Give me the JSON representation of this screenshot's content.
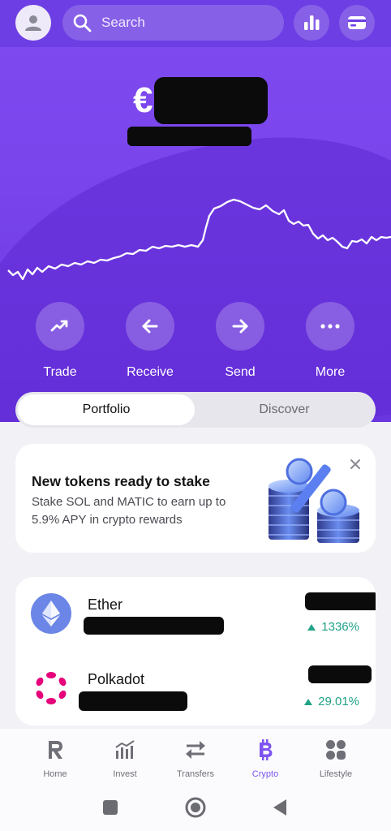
{
  "search": {
    "placeholder": "Search"
  },
  "balance": {
    "currency_symbol": "€"
  },
  "actions": [
    {
      "label": "Trade",
      "icon": "trend-up-icon"
    },
    {
      "label": "Receive",
      "icon": "arrow-left-icon"
    },
    {
      "label": "Send",
      "icon": "arrow-right-icon"
    },
    {
      "label": "More",
      "icon": "more-dots-icon"
    }
  ],
  "segments": {
    "portfolio": "Portfolio",
    "discover": "Discover",
    "selected": "Portfolio"
  },
  "promo": {
    "title": "New tokens ready to stake",
    "text": "Stake SOL and MATIC to earn up to 5.9% APY in crypto rewards"
  },
  "assets": [
    {
      "name": "Ether",
      "change": "1336%",
      "icon": "ether-icon"
    },
    {
      "name": "Polkadot",
      "change": "29.01%",
      "icon": "polkadot-icon"
    }
  ],
  "nav": {
    "items": [
      {
        "label": "Home",
        "icon": "revolut-r-icon"
      },
      {
        "label": "Invest",
        "icon": "bar-chart-icon"
      },
      {
        "label": "Transfers",
        "icon": "transfer-arrows-icon"
      },
      {
        "label": "Crypto",
        "icon": "bitcoin-icon"
      },
      {
        "label": "Lifestyle",
        "icon": "grid-dots-icon"
      }
    ],
    "active": "Crypto"
  },
  "colors": {
    "brand_purple": "#7b4aee",
    "positive": "#20a386",
    "active_nav": "#7d54f0"
  }
}
